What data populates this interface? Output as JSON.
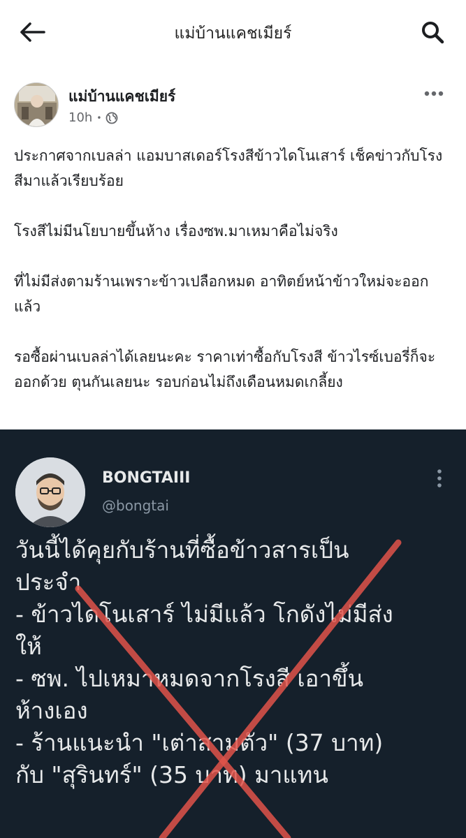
{
  "topbar": {
    "title": "แม่บ้านแคชเมียร์",
    "back_icon": "arrow-left-icon",
    "search_icon": "search-icon"
  },
  "post": {
    "author": "แม่บ้านแคชเมียร์",
    "time": "10h",
    "separator": "•",
    "audience_icon": "globe-icon",
    "more_icon": "more-horizontal-icon",
    "paragraphs": [
      "ประกาศจากเบลล่า แอมบาสเดอร์โรงสีข้าวไดโนเสาร์ เช็คข่าวกับโรงสีมาแล้วเรียบร้อย",
      "โรงสีไม่มีนโยบายขึ้นห้าง เรื่องซพ.มาเหมาคือไม่จริง",
      "ที่ไม่มีส่งตามร้านเพราะข้าวเปลือกหมด อาทิตย์หน้าข้าวใหม่จะออกแล้ว",
      "รอซื้อผ่านเบลล่าได้เลยนะคะ ราคาเท่าซื้อกับโรงสี ข้าวไรซ์เบอรี่ก็จะออกด้วย ตุนกันเลยนะ รอบก่อนไม่ถึงเดือนหมดเกลี้ยง"
    ]
  },
  "embed": {
    "name": "BONGTAIII",
    "handle": "@bongtai",
    "more_icon": "more-vertical-icon",
    "lines": [
      "วันนี้ได้คุยกับร้านที่ซื้อข้าวสารเป็น",
      "ประจำ",
      "- ข้าวไดโนเสาร์ ไม่มีแล้ว โกดังไม่มีส่ง",
      "ให้",
      "- ซพ. ไปเหมาหมดจากโรงสี เอาขึ้น",
      "ห้างเอง",
      "- ร้านแนะนำ \"เต่าสามตัว\" (37 บาท)",
      "กับ \"สุรินทร์\" (35 บาท) มาแทน"
    ],
    "cross_color": "#e0544a"
  }
}
